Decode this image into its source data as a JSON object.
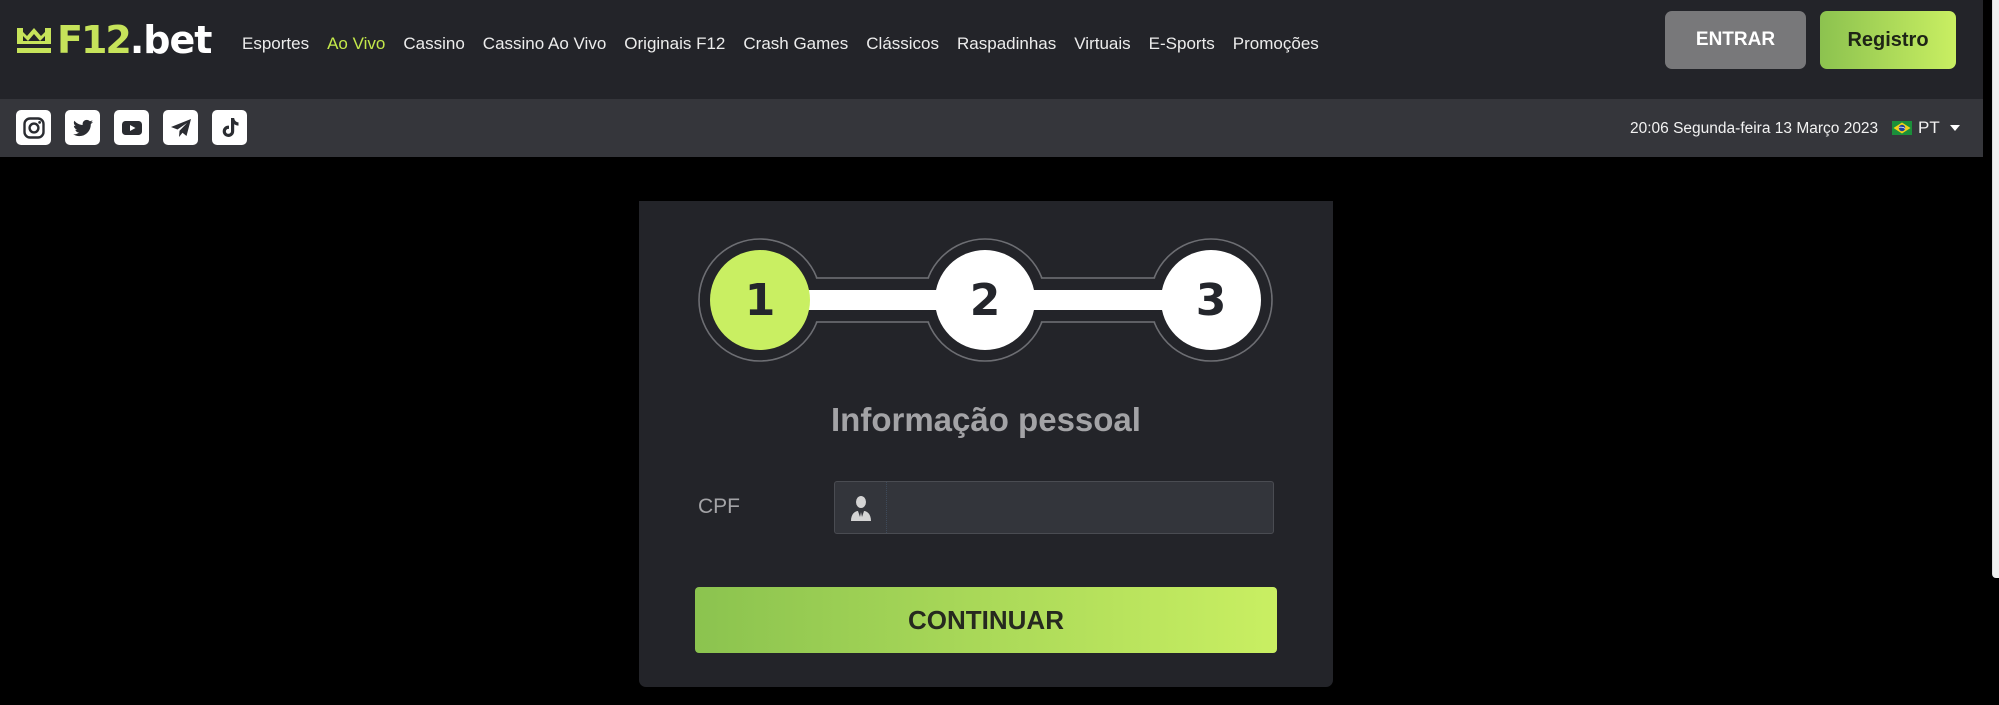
{
  "header": {
    "logo": {
      "f12": "F12",
      "bet": ".bet"
    },
    "nav": [
      {
        "label": "Esportes",
        "active": false
      },
      {
        "label": "Ao Vivo",
        "active": true
      },
      {
        "label": "Cassino",
        "active": false
      },
      {
        "label": "Cassino Ao Vivo",
        "active": false
      },
      {
        "label": "Originais F12",
        "active": false
      },
      {
        "label": "Crash Games",
        "active": false
      },
      {
        "label": "Clássicos",
        "active": false
      },
      {
        "label": "Raspadinhas",
        "active": false
      },
      {
        "label": "Virtuais",
        "active": false
      },
      {
        "label": "E-Sports",
        "active": false
      },
      {
        "label": "Promoções",
        "active": false
      }
    ],
    "login_label": "ENTRAR",
    "register_label": "Registro"
  },
  "subheader": {
    "socials": [
      {
        "icon": "instagram-icon"
      },
      {
        "icon": "twitter-icon"
      },
      {
        "icon": "youtube-icon"
      },
      {
        "icon": "telegram-icon"
      },
      {
        "icon": "tiktok-icon"
      }
    ],
    "datetime": "20:06 Segunda-feira 13 Março 2023",
    "language": {
      "code": "PT",
      "flag": "brazil-flag-icon"
    }
  },
  "registration": {
    "steps": [
      {
        "number": "1",
        "state": "active"
      },
      {
        "number": "2",
        "state": "pending"
      },
      {
        "number": "3",
        "state": "pending"
      }
    ],
    "title": "Informação pessoal",
    "cpf": {
      "label": "CPF",
      "value": "",
      "placeholder": "",
      "icon": "user-icon"
    },
    "continue_label": "CONTINUAR"
  },
  "colors": {
    "accent": "#c3e84a",
    "header_bg": "#232429",
    "subheader_bg": "#35363b",
    "panel_bg": "#232429",
    "step_active": "#c9ef62",
    "step_pending": "#ffffff"
  }
}
